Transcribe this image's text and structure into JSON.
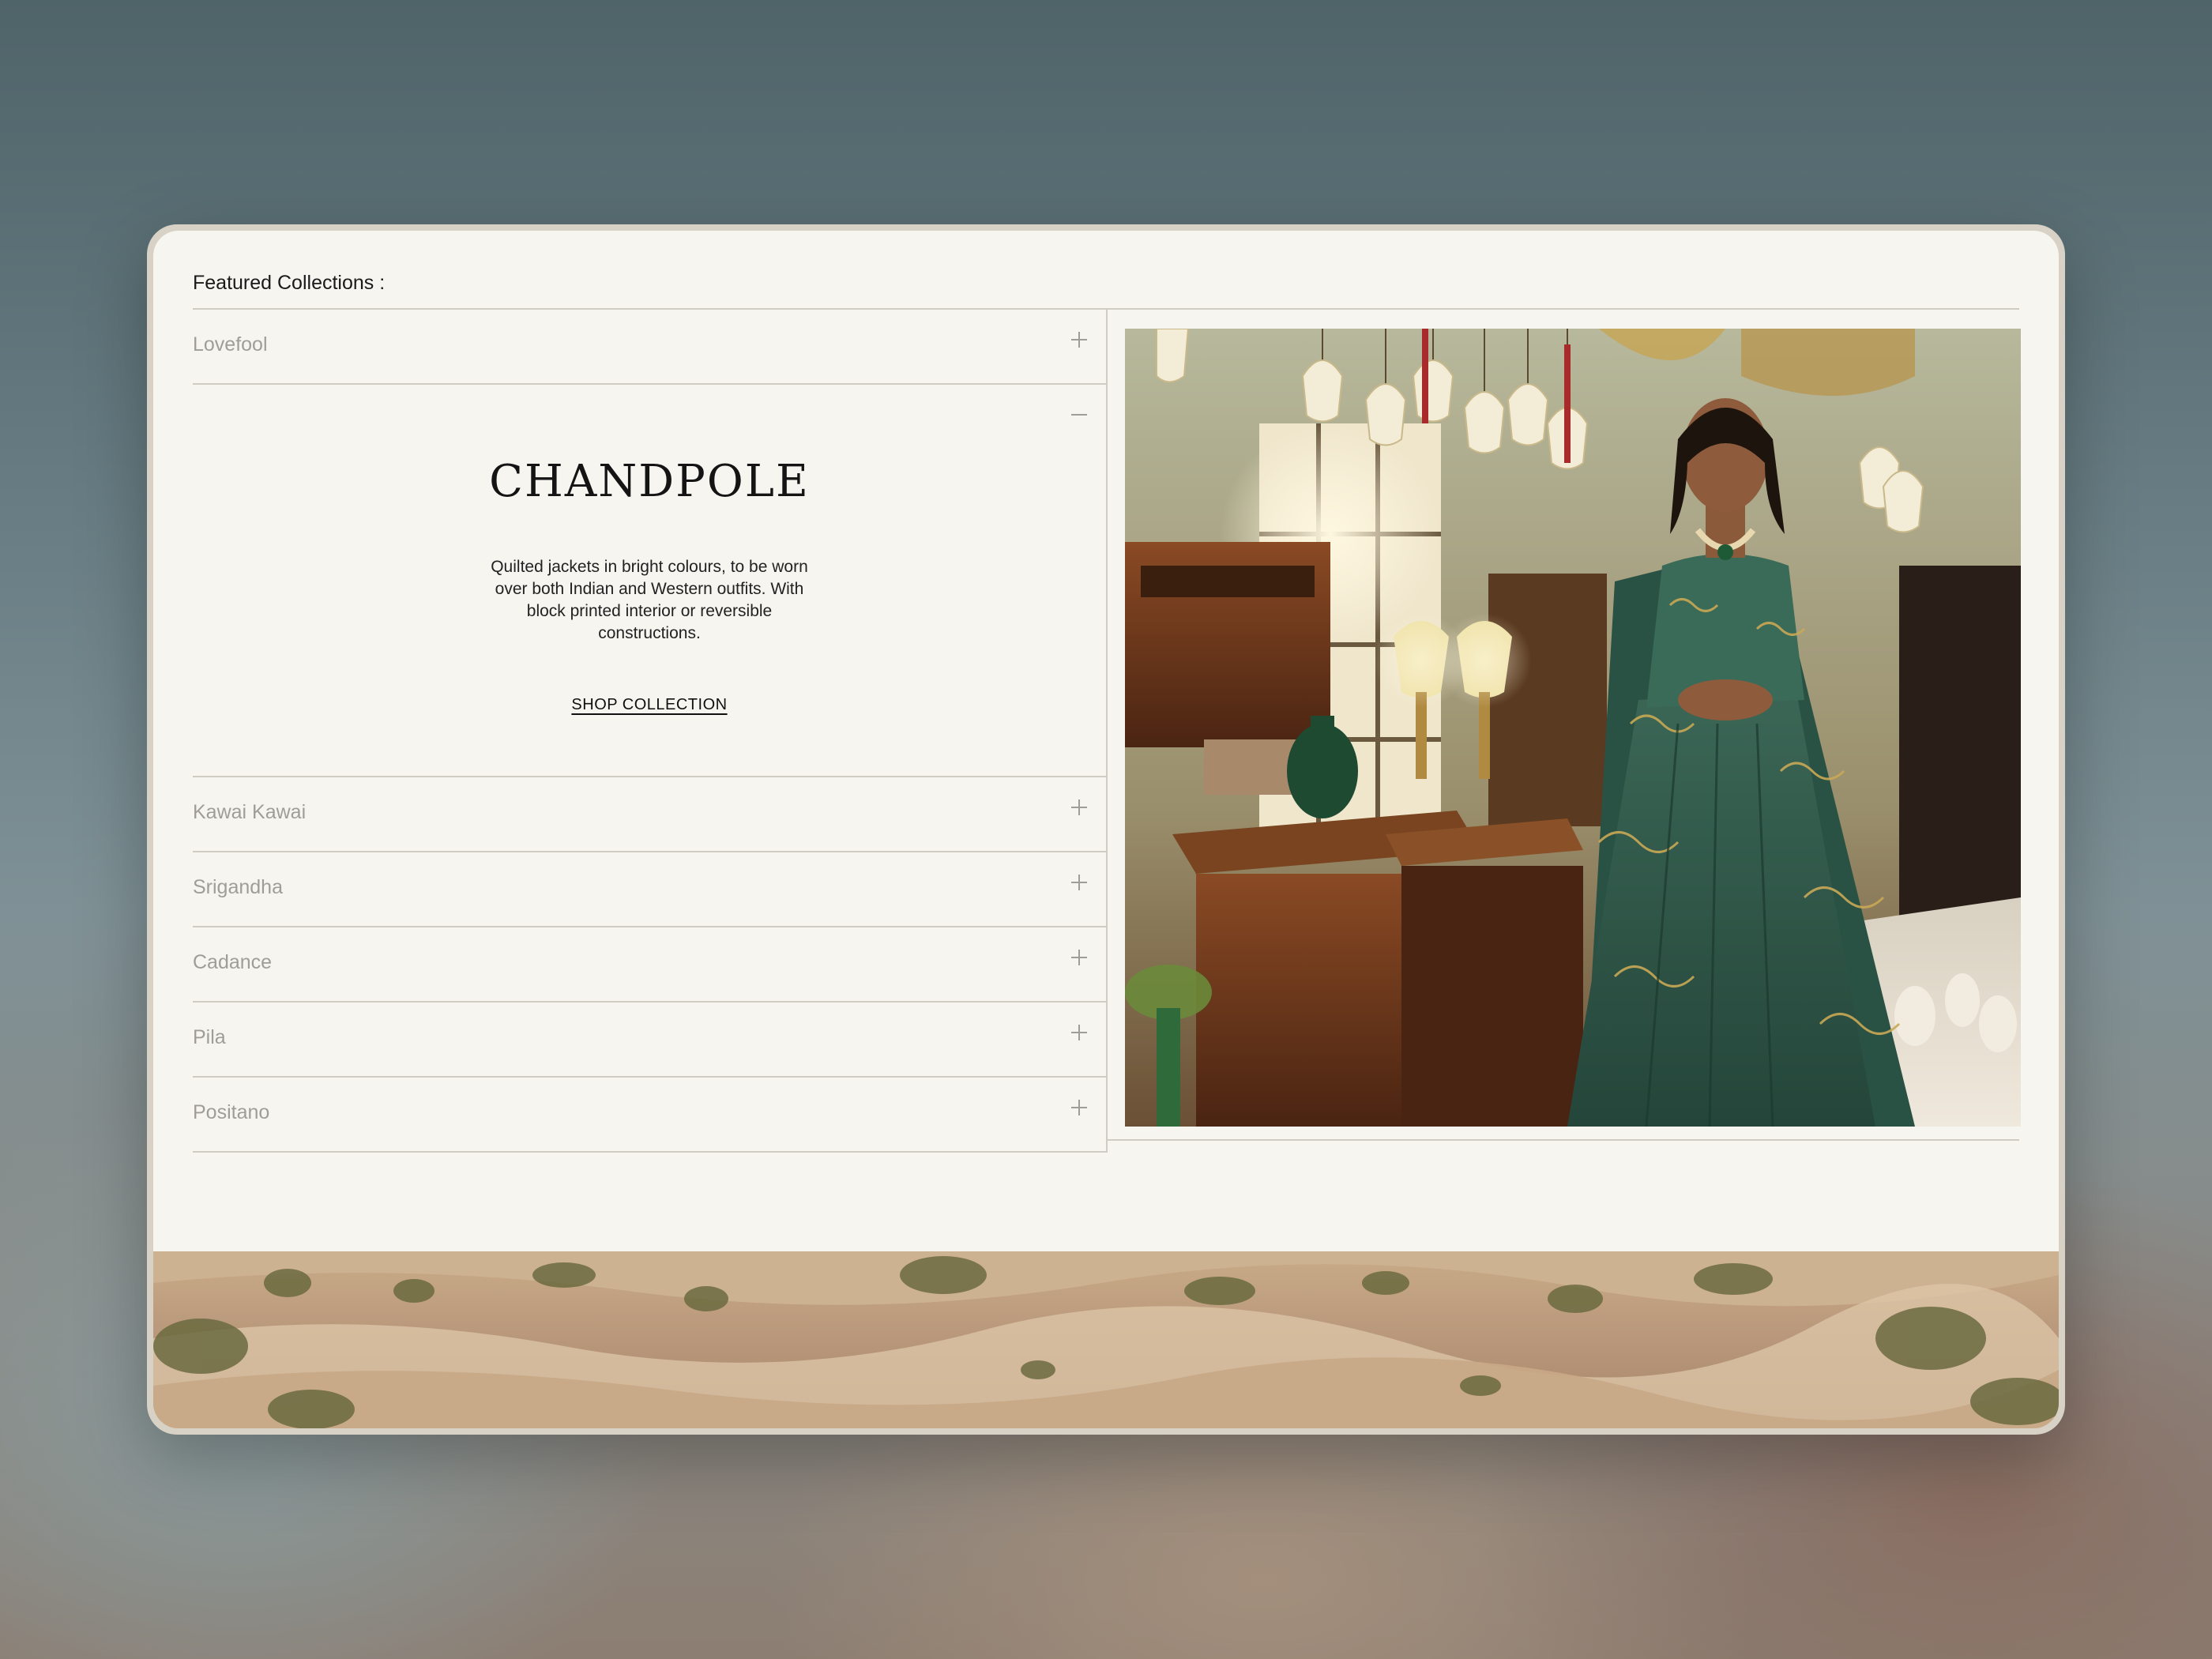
{
  "section": {
    "title": "Featured Collections :"
  },
  "collections": [
    {
      "label": "Lovefool",
      "icon": "plus-icon"
    },
    {
      "label": "Chandpole",
      "icon": "minus-icon"
    },
    {
      "label": "Kawai Kawai",
      "icon": "plus-icon"
    },
    {
      "label": "Srigandha",
      "icon": "plus-icon"
    },
    {
      "label": "Cadance",
      "icon": "plus-icon"
    },
    {
      "label": "Pila",
      "icon": "plus-icon"
    },
    {
      "label": "Positano",
      "icon": "plus-icon"
    }
  ],
  "open_collection": {
    "title": "CHANDPOLE",
    "description": "Quilted jackets in bright colours, to be worn over both Indian and Western outfits. With block printed interior or reversible constructions.",
    "cta_label": "SHOP COLLECTION"
  },
  "colors": {
    "panel_bg": "#f7f5ef",
    "rule": "#cfccc4",
    "muted_text": "#9f9d97",
    "dress_green": "#2f5447"
  }
}
